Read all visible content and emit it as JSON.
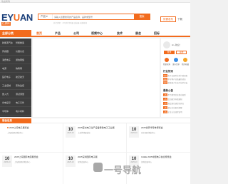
{
  "topbar": {
    "left_text": "欢迎来到"
  },
  "logo": {
    "brand_left": "EY",
    "brand_accent": "U",
    "brand_right": "AN",
    "sub": "亿源网"
  },
  "search": {
    "category": "产品",
    "placeholder": "请输入您要搜索的产品名称、品牌或型号",
    "button": "搜索",
    "hot": "热门搜索：半导体 传感器 连接器 电源模块"
  },
  "actions": {
    "post": "供需发布",
    "more": "下载"
  },
  "nav": {
    "category": "全部分类",
    "items": [
      "首页",
      "产品",
      "公司",
      "视频中心",
      "技术",
      "展会",
      "招标"
    ]
  },
  "sidebar": {
    "rows": [
      [
        "新能源汽车",
        "智能制造"
      ],
      [
        "传感器",
        "仪器仪表"
      ],
      [
        "消费电子",
        "通信网络"
      ],
      [
        "电源",
        "物联网"
      ],
      [
        "医疗电子",
        "航空航天"
      ],
      [
        "工业控制",
        "安防监控"
      ],
      [
        "嵌入式",
        "测试测量"
      ],
      [
        "光电显示",
        "电子元件"
      ],
      [
        "半导体",
        "电子材料"
      ]
    ]
  },
  "right_panel": {
    "greeting": "Hi~欢迎！",
    "login": "登录",
    "register": "注册",
    "quick": [
      {
        "label": "我要采购",
        "color": "#f26b1d",
        "icon": "cart-icon"
      },
      {
        "label": "发布需求",
        "color": "#3a8ee6",
        "icon": "edit-icon"
      },
      {
        "label": "我的收藏",
        "color": "#f5a623",
        "icon": "star-icon"
      }
    ],
    "section_title": "行业快讯",
    "section2_title": "最新公告",
    "news": [
      {
        "tag": "快讯",
        "text": "电子元器件市场行情周报"
      },
      {
        "tag": "快讯",
        "text": "半导体产业链最新动态"
      },
      {
        "tag": "快讯",
        "text": "新能源汽车电子技术论坛"
      }
    ],
    "notices": [
      {
        "tag": "公告",
        "text": "平台供需信息发布规则"
      },
      {
        "tag": "公告",
        "text": "会员服务升级通知"
      },
      {
        "tag": "公告",
        "text": "展会报名通道已开启"
      },
      {
        "tag": "公告",
        "text": "招标信息更新提醒"
      },
      {
        "tag": "公告",
        "text": "企业认证流程说明"
      }
    ]
  },
  "lower": {
    "title": "展会信息"
  },
  "cards": [
    {
      "day": "10",
      "month": "2025-10",
      "title": "2025上海电子展览会",
      "sub": "上海新国际博览中心"
    },
    {
      "day": "10",
      "month": "2025-10",
      "title": "2025亚洲电子生产设备暨微电子工业展",
      "sub": "上海世博展览馆"
    },
    {
      "day": "10",
      "month": "2025-10",
      "title": "2025世界半导体博览会",
      "sub": "南京国际博览中心"
    },
    {
      "day": "10",
      "month": "2025-10",
      "title": "2025上海国际电源展览会",
      "sub": "上海新国际博览中心"
    },
    {
      "day": "10",
      "month": "2025-10",
      "title": "2025深圳国际电子展",
      "sub": "深圳会展中心"
    },
    {
      "day": "10",
      "month": "2025-10",
      "title": "CAEE 2025中国电子信息博览会",
      "sub": "深圳会展中心"
    }
  ],
  "watermark": "一号导航"
}
